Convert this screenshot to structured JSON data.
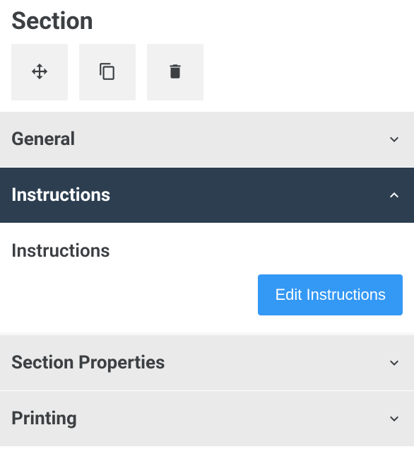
{
  "title": "Section",
  "toolbar": {
    "move_label": "Move",
    "copy_label": "Copy",
    "delete_label": "Delete"
  },
  "panels": {
    "general": {
      "title": "General",
      "expanded": false
    },
    "instructions": {
      "title": "Instructions",
      "expanded": true,
      "subtitle": "Instructions",
      "edit_button_label": "Edit Instructions"
    },
    "section_properties": {
      "title": "Section Properties",
      "expanded": false
    },
    "printing": {
      "title": "Printing",
      "expanded": false
    }
  },
  "colors": {
    "active_bg": "#2c3e50",
    "inactive_bg": "#eaeaea",
    "button_primary": "#3498f5",
    "text_dark": "#3c4043"
  }
}
